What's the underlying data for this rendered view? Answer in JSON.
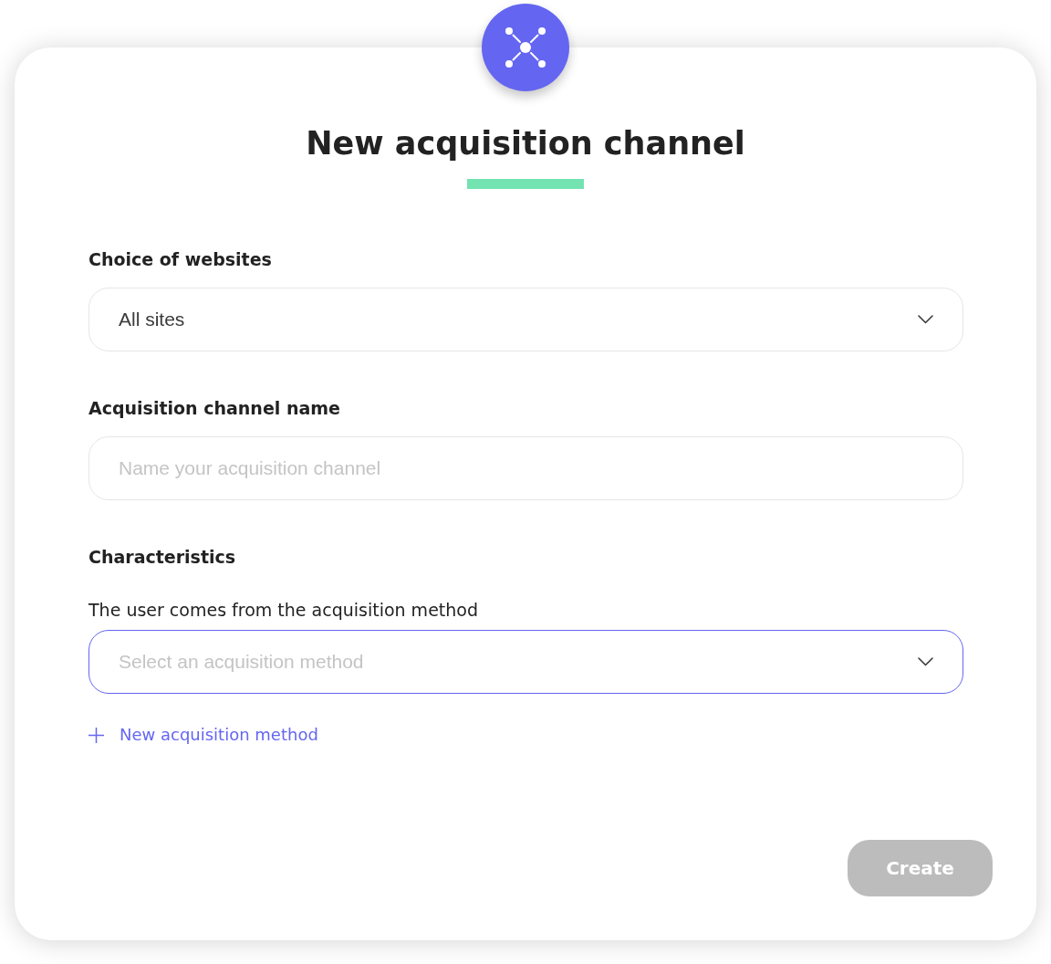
{
  "dialog": {
    "title": "New acquisition channel"
  },
  "fields": [
    {
      "kind": "select",
      "label": "Choice of websites",
      "value": "All sites",
      "focused": false
    },
    {
      "kind": "text",
      "label": "Acquisition channel name",
      "placeholder": "Name your acquisition channel",
      "focused": false
    }
  ],
  "characteristics": {
    "heading": "Characteristics",
    "fields": [
      {
        "kind": "select",
        "label": "The user comes from the acquisition method",
        "placeholder": "Select an acquisition method",
        "focused": true
      }
    ],
    "add_link": "New acquisition method"
  },
  "create_button": {
    "label": "Create",
    "disabled": true
  }
}
